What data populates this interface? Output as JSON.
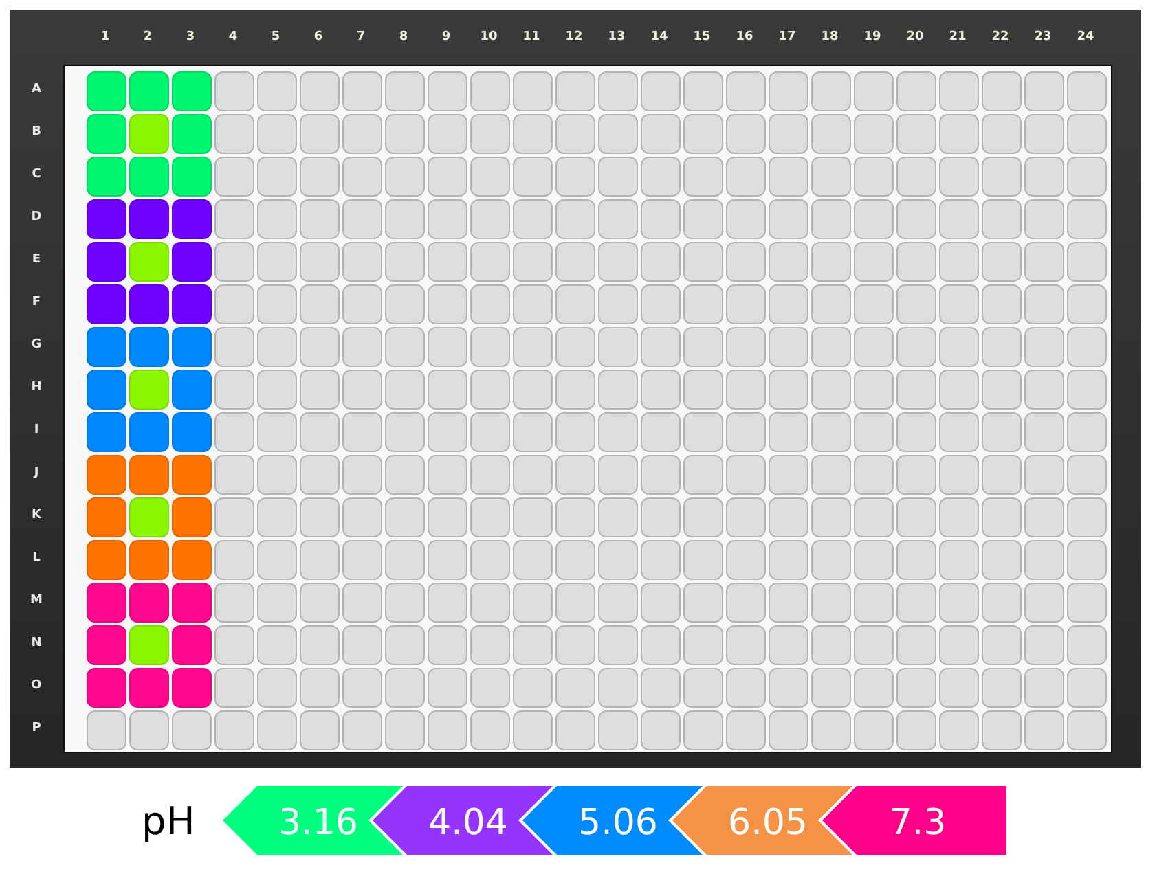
{
  "plate": {
    "columns": [
      "1",
      "2",
      "3",
      "4",
      "5",
      "6",
      "7",
      "8",
      "9",
      "10",
      "11",
      "12",
      "13",
      "14",
      "15",
      "16",
      "17",
      "18",
      "19",
      "20",
      "21",
      "22",
      "23",
      "24"
    ],
    "rows": [
      {
        "label": "A",
        "wells": [
          {
            "color": "#00f56e"
          },
          {
            "color": "#00f56e"
          },
          {
            "color": "#00f56e"
          }
        ]
      },
      {
        "label": "B",
        "wells": [
          {
            "color": "#00f56e"
          },
          {
            "color": "#8cf500"
          },
          {
            "color": "#00f56e"
          }
        ]
      },
      {
        "label": "C",
        "wells": [
          {
            "color": "#00f56e"
          },
          {
            "color": "#00f56e"
          },
          {
            "color": "#00f56e"
          }
        ]
      },
      {
        "label": "D",
        "wells": [
          {
            "color": "#7000ff"
          },
          {
            "color": "#7000ff"
          },
          {
            "color": "#7000ff"
          }
        ]
      },
      {
        "label": "E",
        "wells": [
          {
            "color": "#7000ff"
          },
          {
            "color": "#8cf500"
          },
          {
            "color": "#7000ff"
          }
        ]
      },
      {
        "label": "F",
        "wells": [
          {
            "color": "#7000ff"
          },
          {
            "color": "#7000ff"
          },
          {
            "color": "#7000ff"
          }
        ]
      },
      {
        "label": "G",
        "wells": [
          {
            "color": "#0088ff"
          },
          {
            "color": "#0088ff"
          },
          {
            "color": "#0088ff"
          }
        ]
      },
      {
        "label": "H",
        "wells": [
          {
            "color": "#0088ff"
          },
          {
            "color": "#8cf500"
          },
          {
            "color": "#0088ff"
          }
        ]
      },
      {
        "label": "I",
        "wells": [
          {
            "color": "#0088ff"
          },
          {
            "color": "#0088ff"
          },
          {
            "color": "#0088ff"
          }
        ]
      },
      {
        "label": "J",
        "wells": [
          {
            "color": "#ff7300"
          },
          {
            "color": "#ff7300"
          },
          {
            "color": "#ff7300"
          }
        ]
      },
      {
        "label": "K",
        "wells": [
          {
            "color": "#ff7300"
          },
          {
            "color": "#8cf500"
          },
          {
            "color": "#ff7300"
          }
        ]
      },
      {
        "label": "L",
        "wells": [
          {
            "color": "#ff7300"
          },
          {
            "color": "#ff7300"
          },
          {
            "color": "#ff7300"
          }
        ]
      },
      {
        "label": "M",
        "wells": [
          {
            "color": "#ff0890"
          },
          {
            "color": "#ff0890"
          },
          {
            "color": "#ff0890"
          }
        ]
      },
      {
        "label": "N",
        "wells": [
          {
            "color": "#ff0890"
          },
          {
            "color": "#8cf500"
          },
          {
            "color": "#ff0890"
          }
        ]
      },
      {
        "label": "O",
        "wells": [
          {
            "color": "#ff0890"
          },
          {
            "color": "#ff0890"
          },
          {
            "color": "#ff0890"
          }
        ]
      },
      {
        "label": "P"
      }
    ]
  },
  "legend": {
    "title": "pH",
    "items": [
      {
        "label": "3.16",
        "color": "#00ff7f"
      },
      {
        "label": "4.04",
        "color": "#9533ff"
      },
      {
        "label": "5.06",
        "color": "#008cff"
      },
      {
        "label": "6.05",
        "color": "#f59245"
      },
      {
        "label": "7.3",
        "color": "#ff0088"
      }
    ]
  }
}
